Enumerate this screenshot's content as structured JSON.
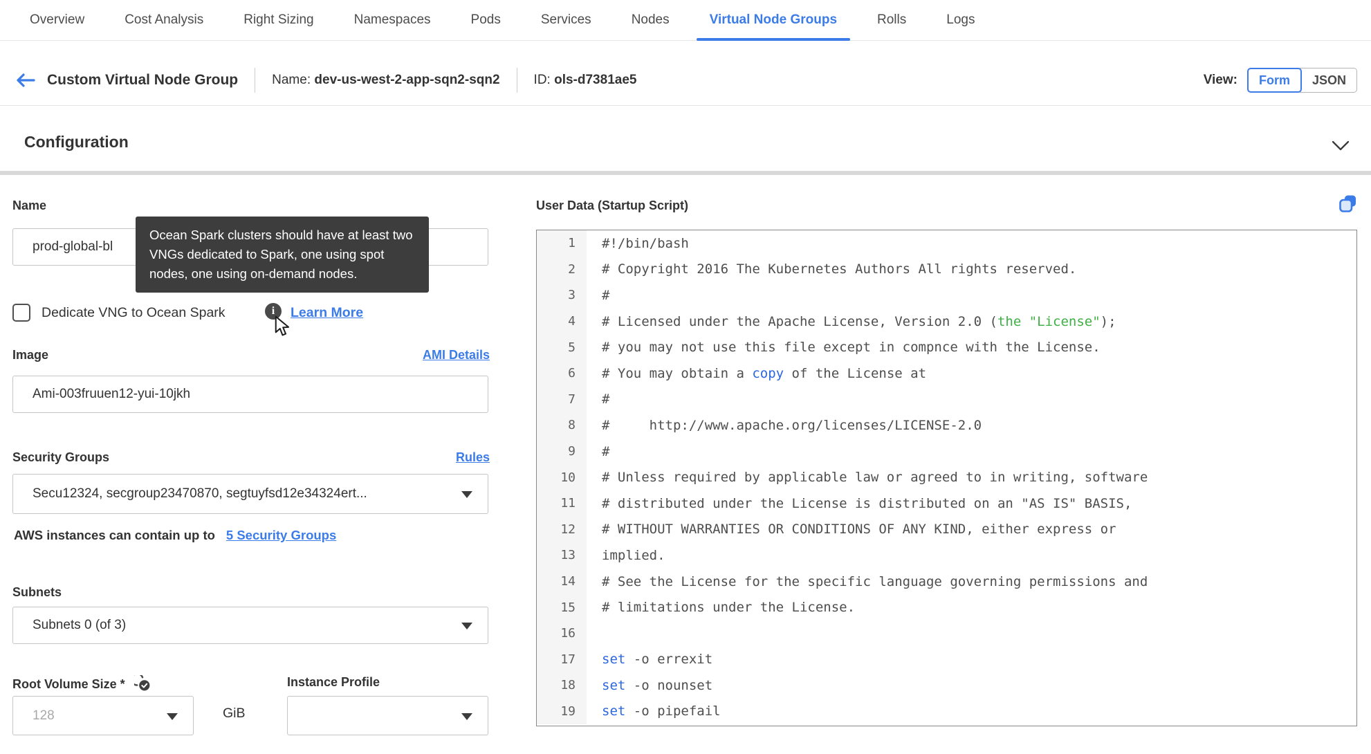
{
  "accent": "#3b7ce8",
  "tabs": {
    "items": [
      {
        "label": "Overview",
        "active": false
      },
      {
        "label": "Cost Analysis",
        "active": false
      },
      {
        "label": "Right Sizing",
        "active": false
      },
      {
        "label": "Namespaces",
        "active": false
      },
      {
        "label": "Pods",
        "active": false
      },
      {
        "label": "Services",
        "active": false
      },
      {
        "label": "Nodes",
        "active": false
      },
      {
        "label": "Virtual Node Groups",
        "active": true
      },
      {
        "label": "Rolls",
        "active": false
      },
      {
        "label": "Logs",
        "active": false
      }
    ]
  },
  "header": {
    "title": "Custom Virtual Node Group",
    "name_label": "Name:",
    "name_value": "dev-us-west-2-app-sqn2-sqn2",
    "id_label": "ID:",
    "id_value": "ols-d7381ae5",
    "view_label": "View:",
    "view_options": [
      {
        "label": "Form",
        "active": true
      },
      {
        "label": "JSON",
        "active": false
      }
    ]
  },
  "section": {
    "title": "Configuration"
  },
  "form": {
    "name": {
      "label": "Name",
      "value": "prod-global-bl"
    },
    "tooltip": {
      "text": "Ocean Spark clusters should have at least two VNGs dedicated to Spark, one using spot nodes, one using on-demand nodes."
    },
    "dedicate": {
      "label": "Dedicate VNG to Ocean Spark",
      "checked": false,
      "learn_more": "Learn More"
    },
    "image": {
      "label": "Image",
      "link": "AMI Details",
      "value": "Ami-003fruuen12-yui-10jkh"
    },
    "security_groups": {
      "label": "Security Groups",
      "link": "Rules",
      "value": "Secu12324, secgroup23470870, segtuyfsd12e34324ert...",
      "caption": "AWS instances can contain up to",
      "caption_link": "5 Security Groups"
    },
    "subnets": {
      "label": "Subnets",
      "value": "Subnets 0 (of 3)"
    },
    "root_volume": {
      "label": "Root Volume Size *",
      "placeholder": "128",
      "unit": "GiB"
    },
    "instance_profile": {
      "label": "Instance Profile",
      "value": ""
    }
  },
  "editor": {
    "label": "User Data (Startup Script)",
    "lines": [
      {
        "n": 1,
        "segs": [
          {
            "t": "#!/bin/bash"
          }
        ]
      },
      {
        "n": 2,
        "segs": [
          {
            "t": "# Copyright 2016 The Kubernetes Authors All rights reserved."
          }
        ]
      },
      {
        "n": 3,
        "segs": [
          {
            "t": "#"
          }
        ]
      },
      {
        "n": 4,
        "segs": [
          {
            "t": "# Licensed under the Apache License, Version 2.0 ("
          },
          {
            "t": "the \"License\"",
            "c": "g"
          },
          {
            "t": ");"
          }
        ]
      },
      {
        "n": 5,
        "segs": [
          {
            "t": "# you may not use this file except in compnce with the License."
          }
        ]
      },
      {
        "n": 6,
        "segs": [
          {
            "t": "# You may obtain a "
          },
          {
            "t": "copy",
            "c": "b"
          },
          {
            "t": " of the License at"
          }
        ]
      },
      {
        "n": 7,
        "segs": [
          {
            "t": "#"
          }
        ]
      },
      {
        "n": 8,
        "segs": [
          {
            "t": "#     http://www.apache.org/licenses/LICENSE-2.0"
          }
        ]
      },
      {
        "n": 9,
        "segs": [
          {
            "t": "#"
          }
        ]
      },
      {
        "n": 10,
        "segs": [
          {
            "t": "# Unless required by applicable law or agreed to in writing, software"
          }
        ]
      },
      {
        "n": 11,
        "segs": [
          {
            "t": "# distributed under the License is distributed on an \"AS IS\" BASIS,"
          }
        ]
      },
      {
        "n": 12,
        "segs": [
          {
            "t": "# WITHOUT WARRANTIES OR CONDITIONS OF ANY KIND, either express or"
          }
        ]
      },
      {
        "n": 13,
        "segs": [
          {
            "t": "implied."
          }
        ]
      },
      {
        "n": 14,
        "segs": [
          {
            "t": "# See the License for the specific language governing permissions and"
          }
        ]
      },
      {
        "n": 15,
        "segs": [
          {
            "t": "# limitations under the License."
          }
        ]
      },
      {
        "n": 16,
        "segs": [
          {
            "t": ""
          }
        ]
      },
      {
        "n": 17,
        "segs": [
          {
            "t": "set",
            "c": "b"
          },
          {
            "t": " -o errexit"
          }
        ]
      },
      {
        "n": 18,
        "segs": [
          {
            "t": "set",
            "c": "b"
          },
          {
            "t": " -o nounset"
          }
        ]
      },
      {
        "n": 19,
        "segs": [
          {
            "t": "set",
            "c": "b"
          },
          {
            "t": " -o pipefail"
          }
        ]
      }
    ]
  }
}
